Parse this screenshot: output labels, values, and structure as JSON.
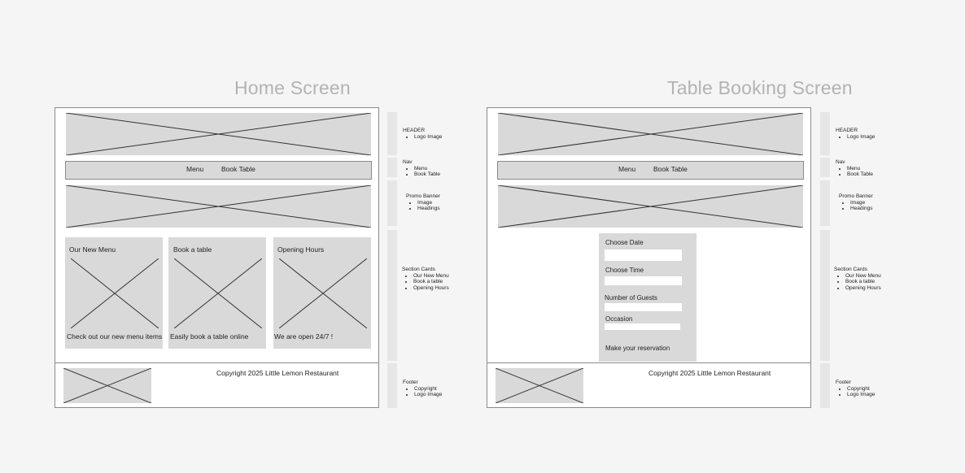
{
  "home": {
    "title": "Home Screen",
    "nav": {
      "menu_label": "Menu",
      "book_label": "Book Table"
    },
    "cards": [
      {
        "title": "Our New Menu",
        "text": "Check out our new menu items"
      },
      {
        "title": "Book a table",
        "text": "Easily book a table online"
      },
      {
        "title": "Opening Hours",
        "text": "We are open 24/7 !"
      }
    ],
    "footer": {
      "copyright": "Copyright 2025 Little Lemon Restaurant"
    }
  },
  "booking": {
    "title": "Table Booking Screen",
    "nav": {
      "menu_label": "Menu",
      "book_label": "Book Table"
    },
    "form": {
      "date_label": "Choose Date",
      "time_label": "Choose Time",
      "guests_label": "Number of Guests",
      "occasion_label": "Occasion",
      "submit_label": "Make your reservation"
    },
    "footer": {
      "copyright": "Copyright 2025 Little Lemon Restaurant"
    }
  },
  "annotations": {
    "header": {
      "title": "HEADER",
      "items": [
        "Logo Image"
      ]
    },
    "nav": {
      "title": "Nav",
      "items": [
        "Menu",
        "Book Table"
      ]
    },
    "promo": {
      "title": "Promo Banner",
      "items": [
        "Image",
        "Headings"
      ]
    },
    "sections": {
      "title": "Section Cards",
      "items": [
        "Our New Menu",
        "Book a table",
        "Opening Hours"
      ]
    },
    "footer": {
      "title": "Footer",
      "items": [
        "Copyright",
        "Logo Image"
      ]
    }
  }
}
